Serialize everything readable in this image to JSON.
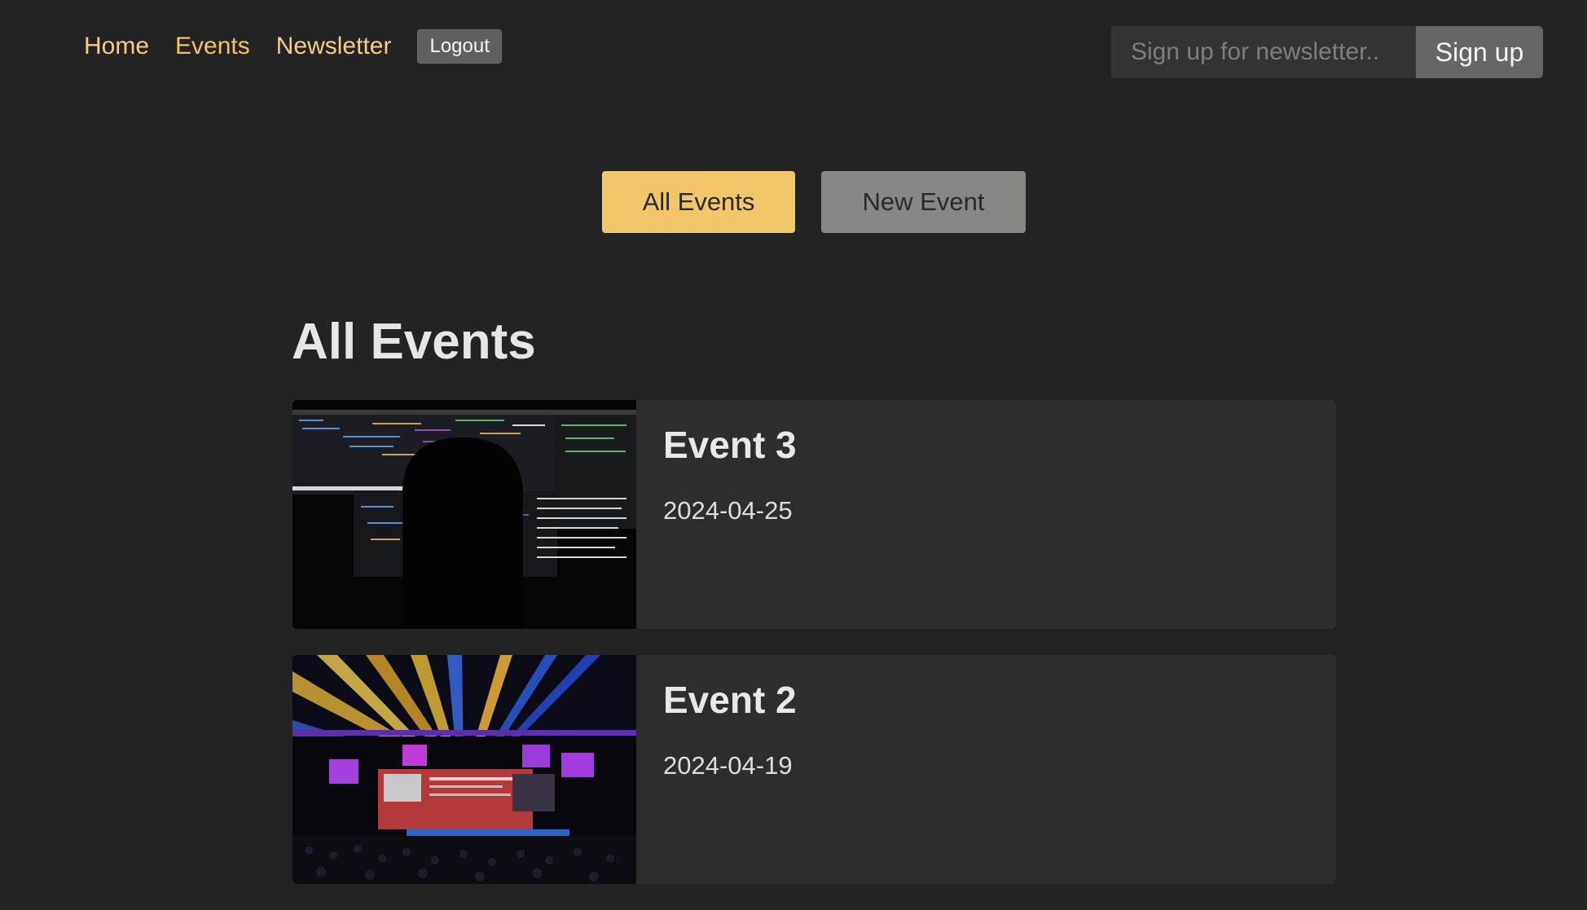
{
  "nav": {
    "home_label": "Home",
    "events_label": "Events",
    "newsletter_label": "Newsletter",
    "logout_label": "Logout"
  },
  "newsletter_signup": {
    "placeholder": "Sign up for newsletter..",
    "button_label": "Sign up"
  },
  "tabs": {
    "all_events_label": "All Events",
    "new_event_label": "New Event"
  },
  "page_title": "All Events",
  "events": [
    {
      "name": "Event 3",
      "date": "2024-04-25",
      "image_icon": "coding-screens-image"
    },
    {
      "name": "Event 2",
      "date": "2024-04-19",
      "image_icon": "conference-stage-image"
    }
  ],
  "colors": {
    "background": "#232323",
    "accent": "#f2c76c",
    "card": "#2e2d2c"
  }
}
